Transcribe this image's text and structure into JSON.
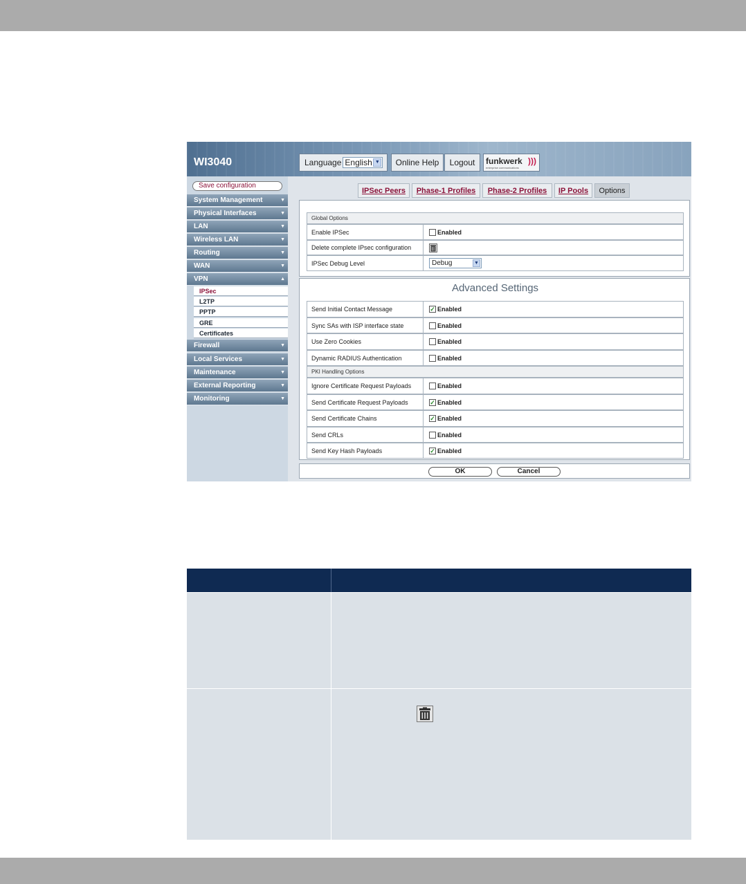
{
  "device": {
    "model": "WI3040",
    "language_label": "Language",
    "language_value": "English",
    "online_help": "Online Help",
    "logout": "Logout",
    "brand": "funkwerk",
    "brand_sub": "enterprise communications"
  },
  "sidebar": {
    "save_config": "Save configuration",
    "items": [
      {
        "label": "System Management"
      },
      {
        "label": "Physical Interfaces"
      },
      {
        "label": "LAN"
      },
      {
        "label": "Wireless LAN"
      },
      {
        "label": "Routing"
      },
      {
        "label": "WAN"
      },
      {
        "label": "VPN"
      },
      {
        "label": "Firewall"
      },
      {
        "label": "Local Services"
      },
      {
        "label": "Maintenance"
      },
      {
        "label": "External Reporting"
      },
      {
        "label": "Monitoring"
      }
    ],
    "vpn_subitems": [
      "IPSec",
      "L2TP",
      "PPTP",
      "GRE",
      "Certificates"
    ],
    "active_subitem": "IPSec"
  },
  "tabs": [
    {
      "label": "IPSec Peers"
    },
    {
      "label": "Phase-1 Profiles"
    },
    {
      "label": "Phase-2 Profiles"
    },
    {
      "label": "IP Pools"
    },
    {
      "label": "Options",
      "active": true
    }
  ],
  "global_options": {
    "header": "Global Options",
    "rows": [
      {
        "label": "Enable IPSec",
        "value": "Enabled",
        "checked": false
      },
      {
        "label": "Delete complete IPsec configuration",
        "icon": "trash-icon"
      },
      {
        "label": "IPSec Debug Level",
        "select": "Debug"
      }
    ]
  },
  "advanced": {
    "title": "Advanced Settings",
    "rows": [
      {
        "label": "Send Initial Contact Message",
        "value": "Enabled",
        "checked": true
      },
      {
        "label": "Sync SAs with ISP interface state",
        "value": "Enabled",
        "checked": false
      },
      {
        "label": "Use Zero Cookies",
        "value": "Enabled",
        "checked": false
      },
      {
        "label": "Dynamic RADIUS Authentication",
        "value": "Enabled",
        "checked": false
      }
    ],
    "pki_header": "PKI Handling Options",
    "pki_rows": [
      {
        "label": "Ignore Certificate Request Payloads",
        "value": "Enabled",
        "checked": false
      },
      {
        "label": "Send Certificate Request Payloads",
        "value": "Enabled",
        "checked": true
      },
      {
        "label": "Send Certificate Chains",
        "value": "Enabled",
        "checked": true
      },
      {
        "label": "Send CRLs",
        "value": "Enabled",
        "checked": false
      },
      {
        "label": "Send Key Hash Payloads",
        "value": "Enabled",
        "checked": true
      }
    ]
  },
  "buttons": {
    "ok": "OK",
    "cancel": "Cancel"
  },
  "colors": {
    "accent": "#8b1239",
    "table_header": "#0f2a52",
    "table_row": "#dbe1e7"
  }
}
